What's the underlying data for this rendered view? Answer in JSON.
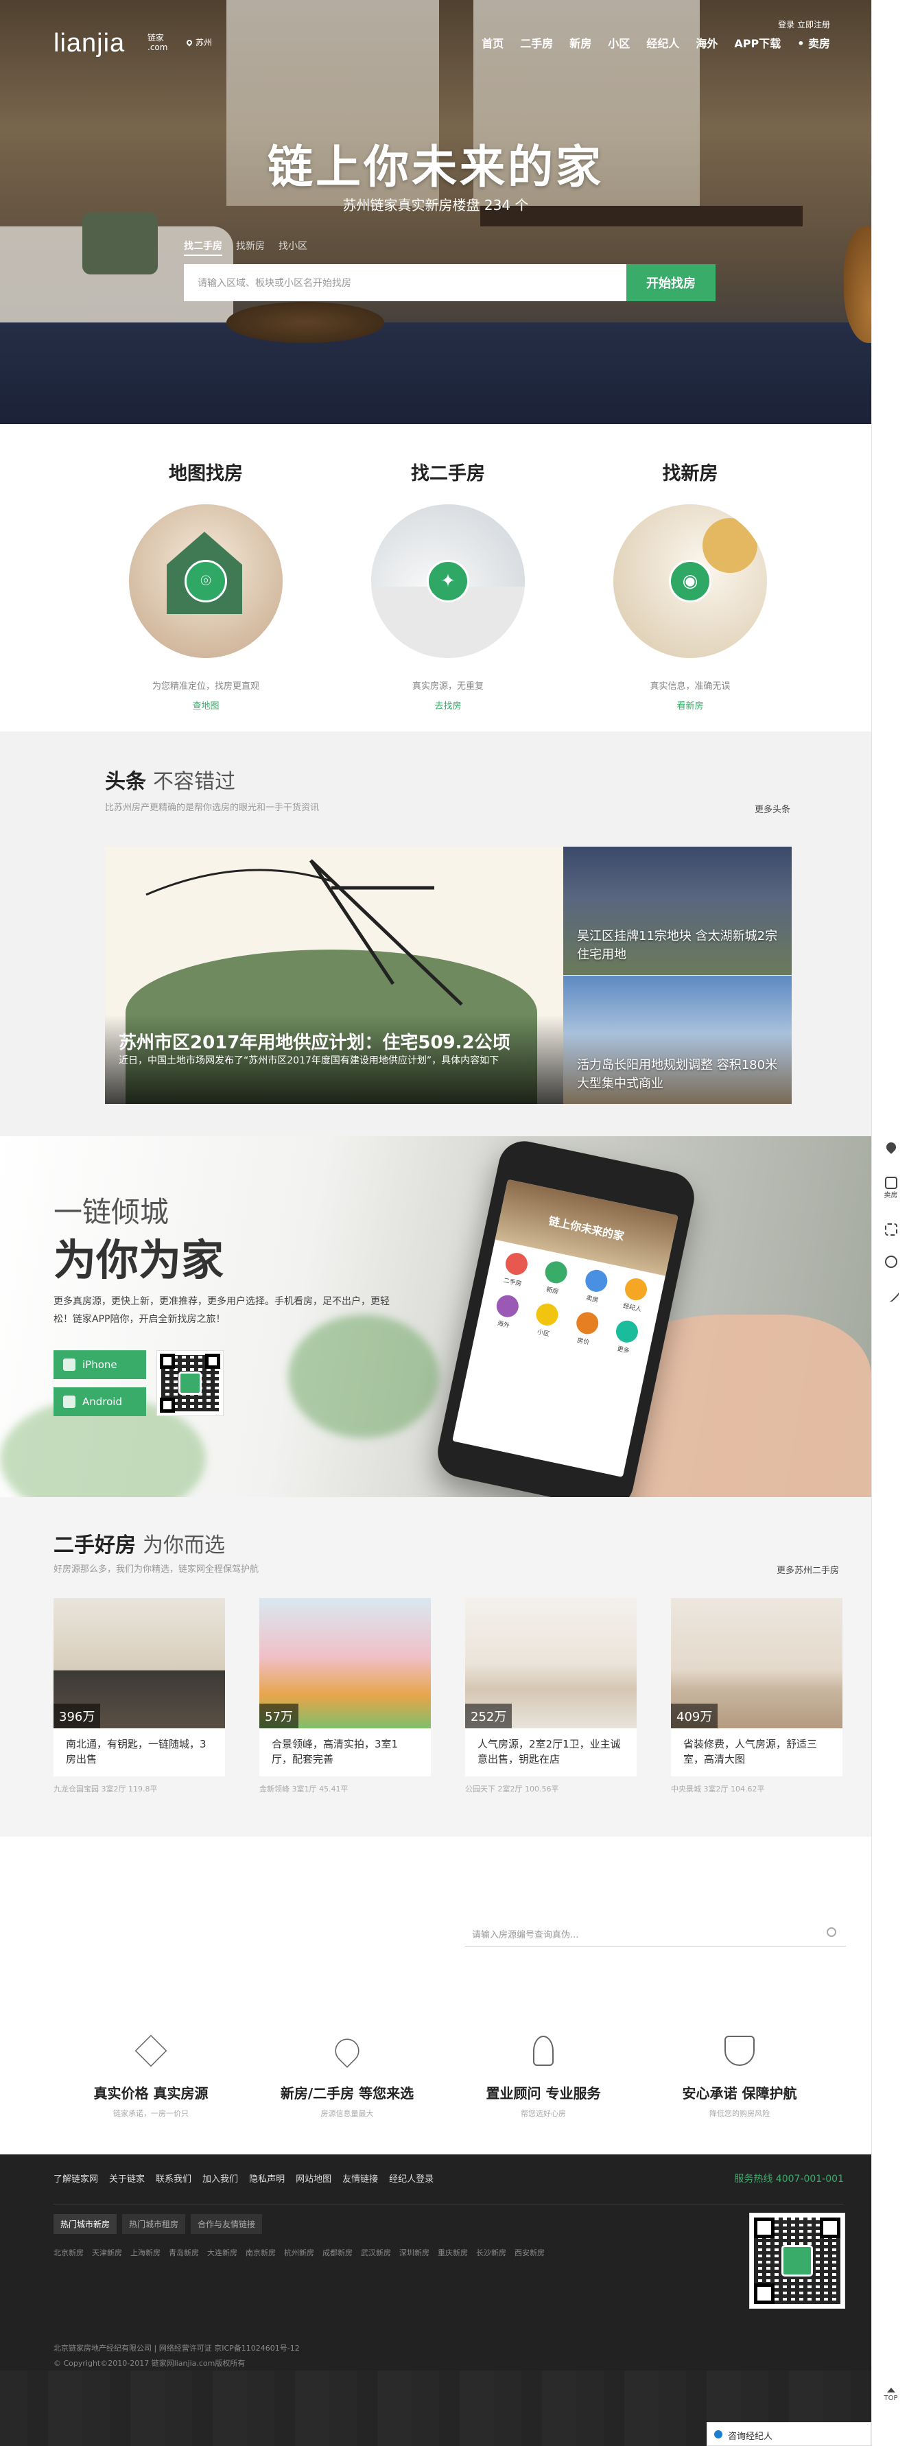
{
  "header": {
    "logo": "lianjia",
    "logo_sub": "链家\n.com",
    "city": "苏州",
    "nav": [
      "首页",
      "二手房",
      "新房",
      "小区",
      "经纪人",
      "海外",
      "APP下载",
      "• 卖房"
    ],
    "login": "登录 立即注册"
  },
  "hero": {
    "title": "链上你未来的家",
    "subtitle": "苏州链家真实新房楼盘 234 个",
    "tabs": [
      "找二手房",
      "找新房",
      "找小区"
    ],
    "search_placeholder": "请输入区域、板块或小区名开始找房",
    "search_button": "开始找房"
  },
  "features": [
    {
      "title": "地图找房",
      "desc": "为您精准定位，找房更直观",
      "link": "查地图"
    },
    {
      "title": "找二手房",
      "desc": "真实房源，无重复",
      "link": "去找房"
    },
    {
      "title": "找新房",
      "desc": "真实信息，准确无误",
      "link": "看新房"
    }
  ],
  "news": {
    "title": "头条",
    "title_thin": "不容错过",
    "desc": "比苏州房产更精确的是帮你选房的眼光和一手干货资讯",
    "more": "更多头条",
    "main_title": "苏州市区2017年用地供应计划：住宅509.2公顷",
    "main_desc": "近日，中国土地市场网发布了“苏州市区2017年度国有建设用地供应计划”，具体内容如下",
    "side": [
      {
        "title": "吴江区挂牌11宗地块 含太湖新城2宗住宅用地"
      },
      {
        "title": "活力岛长阳用地规划调整 容积180米大型集中式商业"
      }
    ]
  },
  "app": {
    "line1": "一链倾城",
    "line2": "为你为家",
    "desc": "更多真房源，更快上新，更准推荐，更多用户选择。手机看房，足不出户，更轻松！链家APP陪你，开启全新找房之旅！",
    "iphone": "iPhone",
    "android": "Android",
    "phone_banner": "链上你未来的家",
    "phone_items": [
      "二手房",
      "新房",
      "卖房",
      "经纪人",
      "海外",
      "小区",
      "房价",
      "更多"
    ]
  },
  "homes": {
    "title": "二手好房",
    "title_thin": "为你而选",
    "desc": "好房源那么多，我们为你精选，链家网全程保驾护航",
    "more": "更多苏州二手房",
    "items": [
      {
        "price": "396万",
        "title": "南北通，有钥匙，一链随城，3房出售",
        "meta": "九龙仓国宝园   3室2厅   119.8平"
      },
      {
        "price": "57万",
        "title": "合景领峰，高清实拍，3室1厅，配套完善",
        "meta": "金新领峰   3室1厅   45.41平"
      },
      {
        "price": "252万",
        "title": "人气房源，2室2厅1卫，业主诚意出售，钥匙在店",
        "meta": "公园天下   2室2厅   100.56平"
      },
      {
        "price": "409万",
        "title": "省装修费，人气房源，舒适三室，高清大图",
        "meta": "中央景城   3室2厅   104.62平"
      }
    ]
  },
  "blank": {
    "search_placeholder": "请输入房源编号查询真伪..."
  },
  "promises": [
    {
      "title": "真实价格 真实房源",
      "sub": "链家承诺，一房一价只"
    },
    {
      "title": "新房/二手房 等您来选",
      "sub": "房源信息量最大"
    },
    {
      "title": "置业顾问 专业服务",
      "sub": "帮您选好心房"
    },
    {
      "title": "安心承诺 保障护航",
      "sub": "降低您的购房风险"
    }
  ],
  "footer": {
    "links": [
      "了解链家网",
      "关于链家",
      "联系我们",
      "加入我们",
      "隐私声明",
      "网站地图",
      "友情链接",
      "经纪人登录"
    ],
    "hotline": "服务热线 4007-001-001",
    "tabs": [
      "热门城市新房",
      "热门城市租房",
      "合作与友情链接"
    ],
    "cities": [
      "北京新房",
      "天津新房",
      "上海新房",
      "青岛新房",
      "大连新房",
      "南京新房",
      "杭州新房",
      "成都新房",
      "武汉新房",
      "深圳新房",
      "重庆新房",
      "长沙新房",
      "西安新房"
    ],
    "copy1": "北京链家房地产经纪有限公司 | 网络经营许可证 京ICP备11024601号-12",
    "copy2": "© Copyright©2010-2017 链家网lianjia.com版权所有"
  },
  "sidebar": {
    "items": [
      "",
      "卖房",
      "",
      "",
      ""
    ],
    "top": "TOP",
    "chat": "咨询经纪人"
  },
  "colors": {
    "accent": "#39ac6a",
    "footer": "#222222"
  }
}
